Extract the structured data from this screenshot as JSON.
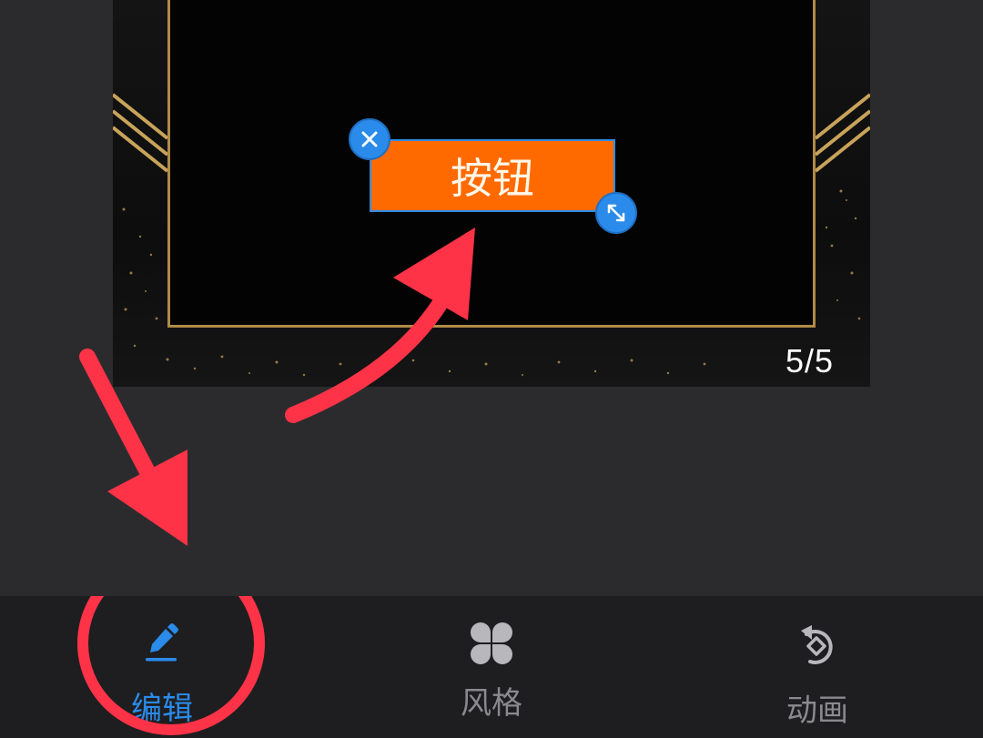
{
  "canvas": {
    "element_label": "按钮",
    "page_indicator": "5/5"
  },
  "tabs": [
    {
      "label": "编辑",
      "icon": "pencil-icon",
      "active": true
    },
    {
      "label": "风格",
      "icon": "four-petal-icon",
      "active": false
    },
    {
      "label": "动画",
      "icon": "rotate-diamond-icon",
      "active": false
    }
  ],
  "colors": {
    "accent": "#2a8bea",
    "element_fill": "#ff6a00",
    "annotation": "#ff3347",
    "gold": "#b08a45",
    "tab_inactive": "#8a8a8e"
  }
}
